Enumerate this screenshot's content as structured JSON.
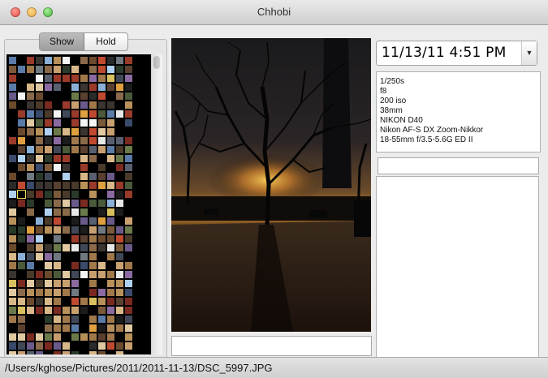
{
  "window": {
    "title": "Chhobi"
  },
  "segmented": {
    "show_label": "Show",
    "hold_label": "Hold"
  },
  "date": {
    "value": "11/13/11 4:51 PM",
    "dropdown_glyph": "▼"
  },
  "exif": [
    "1/250s",
    "f8",
    "200 iso",
    "38mm",
    "NIKON D40",
    "Nikon AF-S DX Zoom-Nikkor",
    "18-55mm f/3.5-5.6G ED II"
  ],
  "status": {
    "path": "/Users/kghose/Pictures/2011/2011-11-13/DSC_5997.JPG"
  },
  "colors": {
    "titlebar_top": "#e9e9e9",
    "swatch_bg": "#000000",
    "selection": "#f0e040"
  },
  "icons": {
    "close": "close-icon",
    "minimize": "minimize-icon",
    "zoom": "zoom-icon",
    "date_dropdown": "chevron-down-icon"
  }
}
